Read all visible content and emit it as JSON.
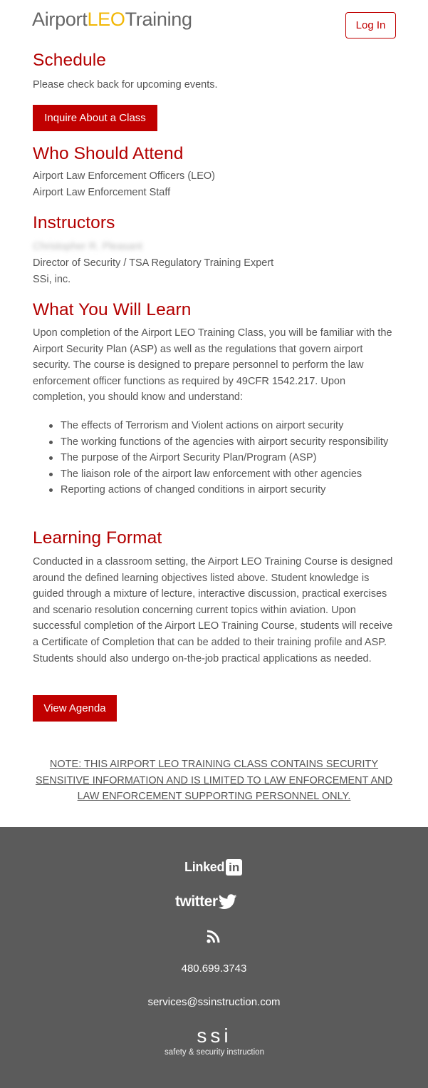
{
  "header": {
    "logo_part1": "Airport",
    "logo_part2": "LEO",
    "logo_part3": "Training",
    "login_label": "Log In"
  },
  "schedule": {
    "title": "Schedule",
    "text": "Please check back for upcoming events.",
    "button_label": "Inquire About a Class"
  },
  "who": {
    "title": "Who Should Attend",
    "items": [
      "Airport Law Enforcement Officers (LEO)",
      "Airport Law Enforcement Staff"
    ]
  },
  "instructors": {
    "title": "Instructors",
    "name": "Christopher R. Pleasant",
    "role": "Director of Security / TSA Regulatory Training Expert",
    "org": "SSi, inc."
  },
  "learn": {
    "title": "What You Will Learn",
    "text": "Upon completion of the Airport LEO Training Class, you will be familiar with the Airport Security Plan (ASP) as well as the regulations that govern airport security. The course is designed to prepare personnel to perform the law enforcement officer functions as required by 49CFR 1542.217. Upon completion, you should know and understand:",
    "bullets": [
      "The effects of Terrorism and Violent actions on airport security",
      "The working functions of the agencies with airport security responsibility",
      "The purpose of the Airport Security Plan/Program (ASP)",
      "The liaison role of the airport law enforcement with other agencies",
      "Reporting actions of changed conditions in airport security"
    ]
  },
  "format": {
    "title": "Learning Format",
    "text": "Conducted in a classroom setting, the Airport LEO Training Course is designed around the defined learning objectives listed above. Student knowledge is guided through a mixture of lecture, interactive discussion, practical exercises and scenario resolution concerning current topics within aviation. Upon successful completion of the Airport LEO Training Course, students will receive a Certificate of Completion that can be added to their training profile and ASP. Students should also undergo on-the-job practical applications as needed.",
    "button_label": "View Agenda"
  },
  "note": "NOTE: THIS AIRPORT LEO TRAINING CLASS CONTAINS SECURITY SENSITIVE INFORMATION AND IS LIMITED TO LAW ENFORCEMENT AND LAW ENFORCEMENT SUPPORTING PERSONNEL ONLY.",
  "footer": {
    "linkedin_word": "Linked",
    "linkedin_badge": "in",
    "twitter_word": "twitter",
    "rss_icon": "rss-icon",
    "phone": "480.699.3743",
    "email": "services@ssinstruction.com",
    "ssi_mark": "ssi",
    "ssi_tagline": "safety & security instruction"
  },
  "colors": {
    "brand_red": "#c00000",
    "heading_red": "#b30000",
    "logo_yellow": "#f2b705",
    "footer_bg": "#5b5b5b"
  }
}
